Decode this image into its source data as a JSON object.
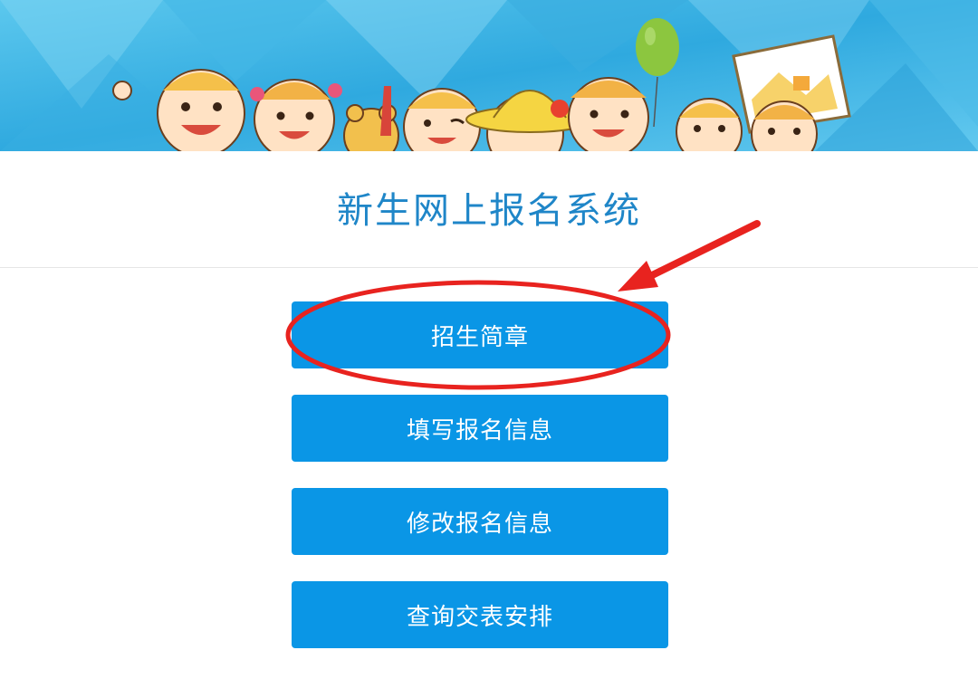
{
  "header": {
    "title": "新生网上报名系统"
  },
  "menu": {
    "items": [
      {
        "label": "招生简章"
      },
      {
        "label": "填写报名信息"
      },
      {
        "label": "修改报名信息"
      },
      {
        "label": "查询交表安排"
      }
    ]
  },
  "colors": {
    "accent": "#0a96e6",
    "title": "#1f86c8",
    "annotation": "#e8231f",
    "banner": "#3fb5e6"
  },
  "icons": {
    "banner": "cartoon-children-banner",
    "annotation_ellipse": "highlight-ellipse",
    "annotation_arrow": "pointer-arrow"
  }
}
